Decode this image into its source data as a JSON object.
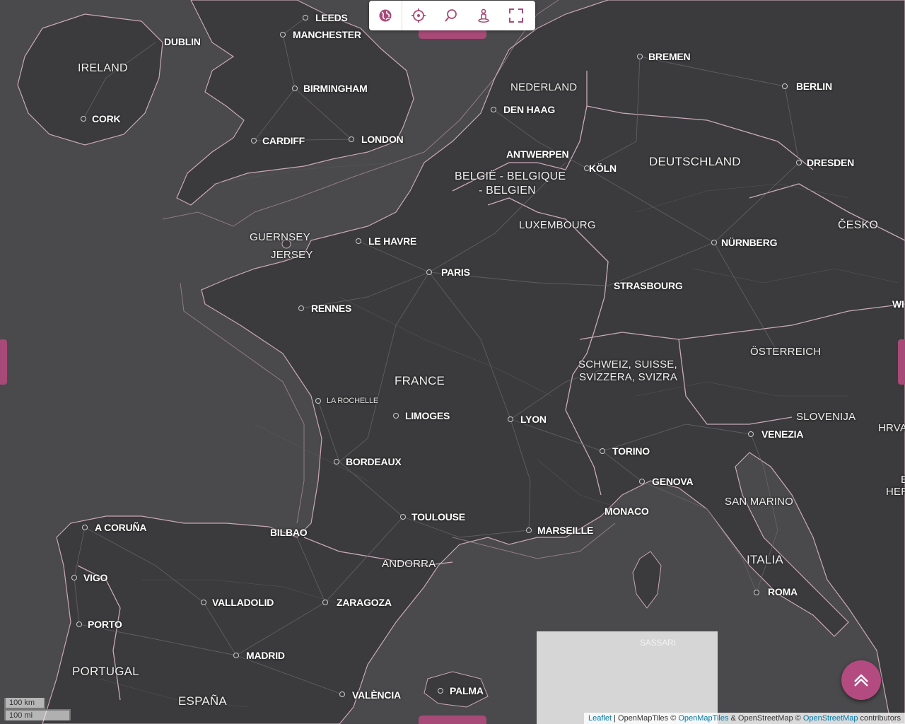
{
  "toolbar": {
    "buttons": [
      {
        "name": "globe-icon"
      },
      {
        "name": "crosshair-icon"
      },
      {
        "name": "search-icon"
      },
      {
        "name": "person-location-icon"
      },
      {
        "name": "fullscreen-icon"
      }
    ]
  },
  "colors": {
    "land": "#3b3a3c",
    "water": "#4a494b",
    "border": "#c9a9b6",
    "accent": "#b34a80"
  },
  "places": {
    "leeds": "LEEDS",
    "manchester": "MANCHESTER",
    "dublin": "DUBLIN",
    "ireland": "IRELAND",
    "birmingham": "BIRMINGHAM",
    "cork": "CORK",
    "cardiff": "CARDIFF",
    "london": "LONDON",
    "guernsey": "GUERNSEY",
    "jersey": "JERSEY",
    "le_havre": "LE HAVRE",
    "paris": "PARIS",
    "rennes": "RENNES",
    "france": "FRANCE",
    "la_rochelle": "LA ROCHELLE",
    "limoges": "LIMOGES",
    "lyon": "LYON",
    "bordeaux": "BORDEAUX",
    "toulouse": "TOULOUSE",
    "marseille": "MARSEILLE",
    "monaco": "MONACO",
    "andorra": "ANDORRA",
    "bilbao": "BILBAO",
    "a_coruna": "A CORUÑA",
    "vigo": "VIGO",
    "porto": "PORTO",
    "portugal": "PORTUGAL",
    "valladolid": "VALLADOLID",
    "zaragoza": "ZARAGOZA",
    "madrid": "MADRID",
    "espana": "ESPAÑA",
    "valencia": "VALÈNCIA",
    "palma": "PALMA",
    "sassari": "SASSARI",
    "bremen": "BREMEN",
    "nederland": "NEDERLAND",
    "den_haag": "DEN HAAG",
    "berlin": "BERLIN",
    "antwerpen": "ANTWERPEN",
    "belgie_1": "BELGIË - BELGIQUE",
    "belgie_2": "- BELGIEN",
    "koln": "KÖLN",
    "deutschland": "DEUTSCHLAND",
    "dresden": "DRESDEN",
    "luxembourg": "LUXEMBOURG",
    "cesko": "ČESKO",
    "nurnberg": "NÜRNBERG",
    "strasbourg": "STRASBOURG",
    "wi": "WI",
    "osterreich": "ÖSTERREICH",
    "schweiz_1": "SCHWEIZ, SUISSE,",
    "schweiz_2": "SVIZZERA, SVIZRA",
    "slovenija": "SLOVENIJA",
    "hrva": "HRVA",
    "venezia": "VENEZIA",
    "torino": "TORINO",
    "genova": "GENOVA",
    "san_marino": "SAN MARINO",
    "italia": "ITALIA",
    "roma": "ROMA",
    "e": "E",
    "her": "HER"
  },
  "scale": {
    "km": "100 km",
    "mi": "100 mi"
  },
  "attribution": {
    "leaflet": "Leaflet",
    "sep": " | OpenMapTiles © ",
    "openmaptiles": "OpenMapTiles",
    "mid": " & OpenStreetMap © ",
    "openstreetmap": "OpenStreetMap",
    "end": " contributors"
  }
}
